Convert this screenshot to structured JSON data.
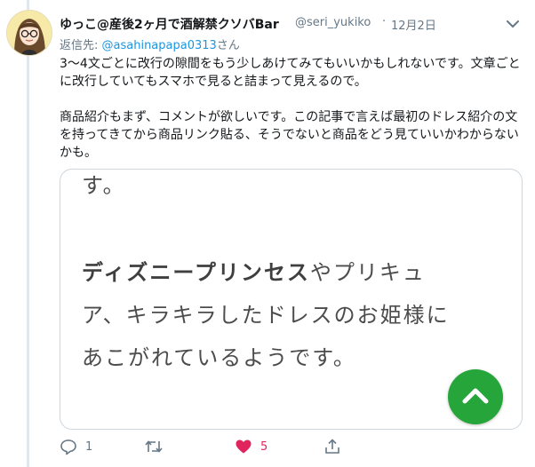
{
  "tweet": {
    "author_name": "ゆっこ@産後2ヶ月で酒解禁クソバBar",
    "author_handle": "@seri_yukiko",
    "separator": "·",
    "date": "12月2日",
    "reply_prefix": "返信先: ",
    "reply_to": "@asahinapapa0313",
    "reply_suffix": "さん",
    "paragraphs": [
      "3〜4文ごとに改行の隙間をもう少しあけてみてもいいかもしれないです。文章ごとに改行していてもスマホで見ると詰まって見えるので。",
      "商品紹介もまず、コメントが欲しいです。この記事で言えば最初のドレス紹介の文を持ってきてから商品リンク貼る、そうでないと商品をどう見ていいかわからないかも。"
    ]
  },
  "card": {
    "line0": "す。",
    "line1_bold": "ディズニープリンセス",
    "line1_rest": "やプリキュ",
    "line2": "ア、キラキラしたドレスのお姫様に",
    "line3": "あこがれているようです。",
    "fab_color": "#25a53a"
  },
  "actions": {
    "reply_count": "1",
    "retweet_count": "",
    "like_count": "5",
    "like_color": "#e0245e",
    "icons": [
      "reply-icon",
      "retweet-icon",
      "heart-icon",
      "share-icon"
    ]
  }
}
